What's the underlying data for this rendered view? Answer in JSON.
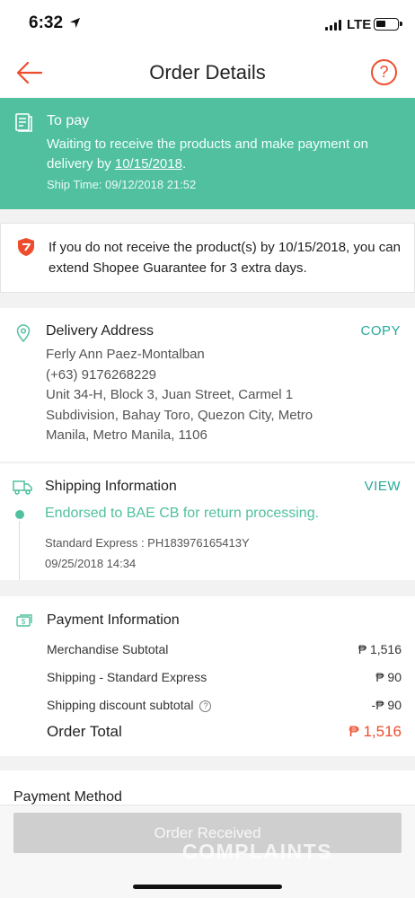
{
  "status_bar": {
    "time": "6:32",
    "network": "LTE"
  },
  "nav": {
    "title": "Order Details"
  },
  "banner": {
    "title": "To pay",
    "desc_prefix": "Waiting to receive the products and make payment on delivery by ",
    "desc_date": "10/15/2018",
    "desc_suffix": ".",
    "ship_time": "Ship Time: 09/12/2018 21:52"
  },
  "guarantee": {
    "text": "If you do not receive the product(s) by 10/15/2018, you can extend Shopee Guarantee for 3 extra days."
  },
  "address": {
    "title": "Delivery Address",
    "copy_label": "COPY",
    "name": "Ferly Ann Paez-Montalban",
    "phone": "(+63) 9176268229",
    "street": "Unit 34-H, Block 3, Juan Street, Carmel 1 Subdivision, Bahay Toro, Quezon City, Metro Manila, Metro Manila, 1106"
  },
  "shipping": {
    "title": "Shipping Information",
    "view_label": "VIEW",
    "status": "Endorsed to BAE CB for return processing.",
    "tracking": "Standard Express :  PH183976165413Y",
    "time": "09/25/2018 14:34"
  },
  "payment": {
    "title": "Payment Information",
    "rows": [
      {
        "label": "Merchandise Subtotal",
        "value": "₱ 1,516"
      },
      {
        "label": "Shipping - Standard Express",
        "value": "₱ 90"
      },
      {
        "label": "Shipping discount subtotal",
        "value": "-₱ 90"
      }
    ],
    "total_label": "Order Total",
    "total_value": "₱ 1,516"
  },
  "payment_method": {
    "title": "Payment Method"
  },
  "bottom": {
    "button_label": "Order Received",
    "watermark": "COMPLAINTS"
  },
  "colors": {
    "brand": "#ee4d2d",
    "banner": "#51c09f",
    "link": "#26aa99"
  },
  "icons": [
    "back-arrow-icon",
    "help-icon",
    "receipt-icon",
    "shield-icon",
    "location-pin-icon",
    "truck-icon",
    "money-icon",
    "info-icon"
  ]
}
